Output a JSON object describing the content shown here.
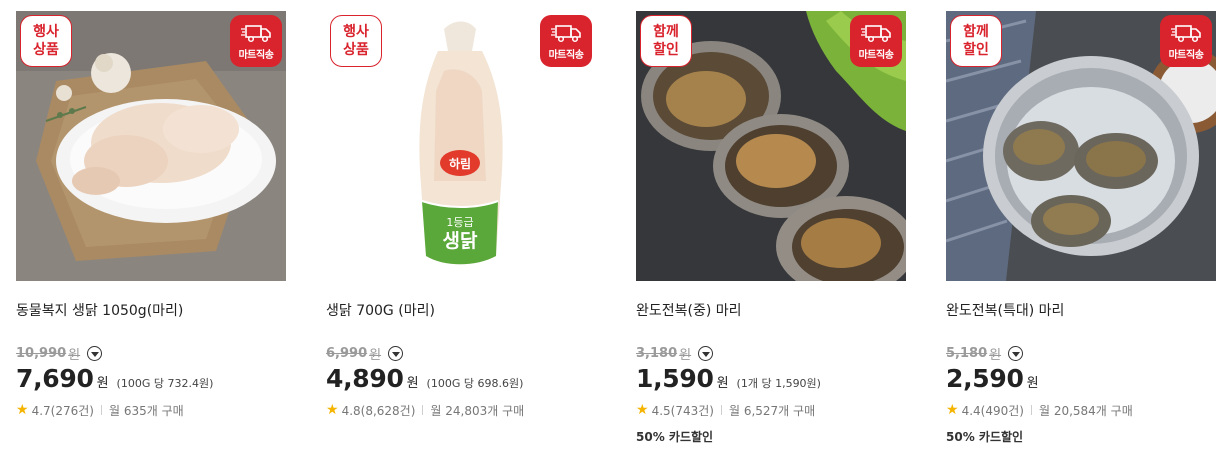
{
  "delivery_badge_label": "마트직송",
  "products": [
    {
      "tag": "행사\n상품",
      "name": "동물복지 생닭 1050g(마리)",
      "original_price": "10,990",
      "currency": "원",
      "price": "7,690",
      "unit_price": "(100G 당 732.4원)",
      "rating": "4.7(276건)",
      "monthly_sales": "월 635개 구매",
      "promo": ""
    },
    {
      "tag": "행사\n상품",
      "name": "생닭 700G (마리)",
      "original_price": "6,990",
      "currency": "원",
      "price": "4,890",
      "unit_price": "(100G 당 698.6원)",
      "rating": "4.8(8,628건)",
      "monthly_sales": "월 24,803개 구매",
      "promo": "",
      "package_brand": "하림",
      "package_grade": "1등급",
      "package_label": "생닭"
    },
    {
      "tag": "함께\n할인",
      "name": "완도전복(중) 마리",
      "original_price": "3,180",
      "currency": "원",
      "price": "1,590",
      "unit_price": "(1개 당 1,590원)",
      "rating": "4.5(743건)",
      "monthly_sales": "월 6,527개 구매",
      "promo": "50% 카드할인"
    },
    {
      "tag": "함께\n할인",
      "name": "완도전복(특대) 마리",
      "original_price": "5,180",
      "currency": "원",
      "price": "2,590",
      "unit_price": "",
      "rating": "4.4(490건)",
      "monthly_sales": "월 20,584개 구매",
      "promo": "50% 카드할인"
    }
  ]
}
